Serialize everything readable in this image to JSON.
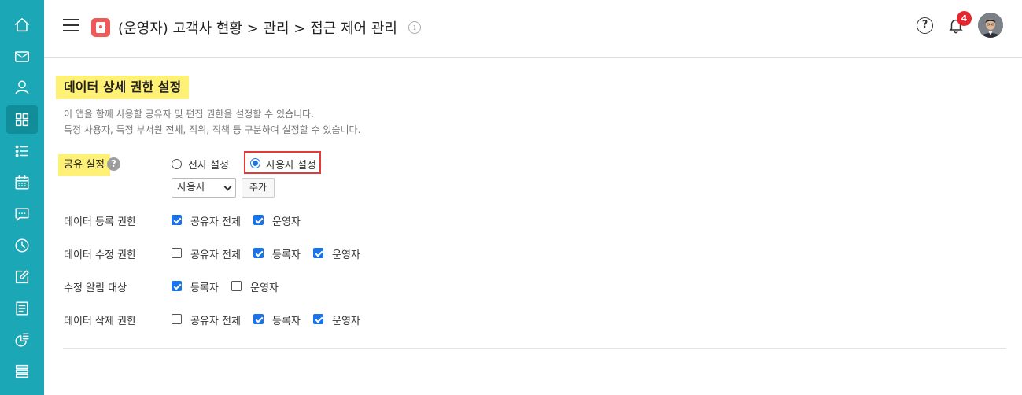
{
  "sidebar": {
    "items": [
      {
        "icon": "home-icon"
      },
      {
        "icon": "mail-icon"
      },
      {
        "icon": "user-icon"
      },
      {
        "icon": "grid-icon",
        "active": true
      },
      {
        "icon": "list-icon"
      },
      {
        "icon": "calendar-icon"
      },
      {
        "icon": "chat-icon"
      },
      {
        "icon": "clock-icon"
      },
      {
        "icon": "edit-icon"
      },
      {
        "icon": "document-icon"
      },
      {
        "icon": "chart-icon"
      },
      {
        "icon": "stack-icon"
      }
    ]
  },
  "header": {
    "title": "(운영자) 고객사 현황 > 관리 > 접근 제어 관리",
    "info_glyph": "i",
    "help_glyph": "?",
    "notification_count": "4"
  },
  "section": {
    "title": "데이터 상세 권한 설정",
    "description_1": "이 앱을 함께 사용할 공유자 및 편집 권한을 설정할 수 있습니다.",
    "description_2": "특정 사용자, 특정 부서원 전체, 직위, 직책 등 구분하여 설정할 수 있습니다."
  },
  "share": {
    "label": "공유 설정",
    "help_glyph": "?",
    "option_all": "전사 설정",
    "option_user": "사용자 설정",
    "selected": "사용자 설정",
    "select_value": "사용자",
    "add_label": "추가"
  },
  "permissions": {
    "register": {
      "label": "데이터 등록 권한",
      "options": [
        {
          "label": "공유자 전체",
          "checked": true
        },
        {
          "label": "운영자",
          "checked": true
        }
      ]
    },
    "edit": {
      "label": "데이터 수정 권한",
      "options": [
        {
          "label": "공유자 전체",
          "checked": false
        },
        {
          "label": "등록자",
          "checked": true
        },
        {
          "label": "운영자",
          "checked": true
        }
      ]
    },
    "notify": {
      "label": "수정 알림 대상",
      "options": [
        {
          "label": "등록자",
          "checked": true
        },
        {
          "label": "운영자",
          "checked": false
        }
      ]
    },
    "delete": {
      "label": "데이터 삭제 권한",
      "options": [
        {
          "label": "공유자 전체",
          "checked": false
        },
        {
          "label": "등록자",
          "checked": true
        },
        {
          "label": "운영자",
          "checked": true
        }
      ]
    }
  },
  "colors": {
    "sidebar": "#1ba7b5",
    "highlight": "#fff176",
    "accent": "#1a73e8",
    "badge": "#e5262d"
  }
}
